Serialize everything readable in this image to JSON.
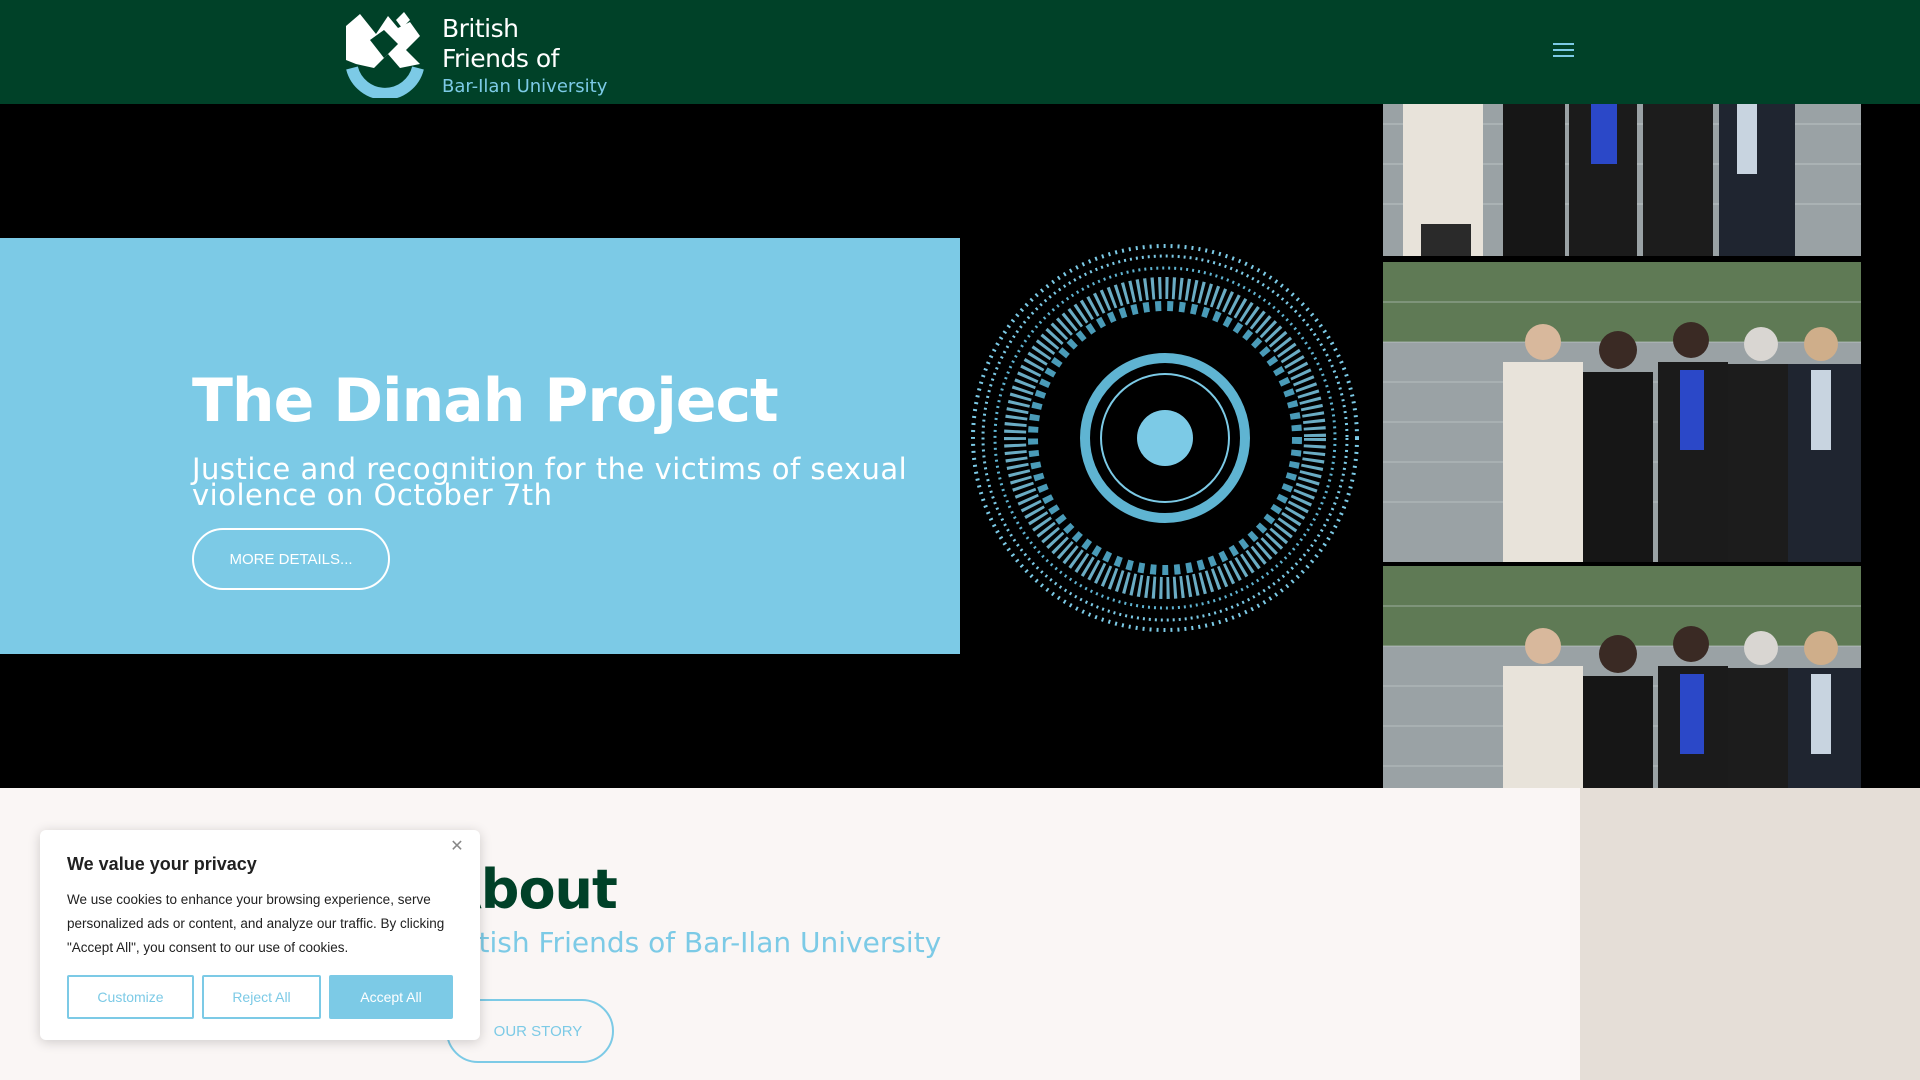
{
  "colors": {
    "header_bg": "#004128",
    "accent_blue": "#7ccae6",
    "hero_bg": "#000000",
    "page_bg": "#faf6f5",
    "side_panel": "#e5ded7"
  },
  "header": {
    "logo": {
      "line1": "British",
      "line2": "Friends of",
      "line3": "Bar-Ilan University",
      "icon": "bar-ilan-emblem-icon"
    },
    "menu_icon": "hamburger-menu-icon"
  },
  "hero": {
    "title": "The Dinah Project",
    "subtitle": "Justice and recognition for the victims of sexual violence on October 7th",
    "button_label": "MORE DETAILS..."
  },
  "about": {
    "title": "About",
    "subtitle": "British Friends of Bar-Ilan University",
    "button_label": "OUR STORY"
  },
  "cookie_banner": {
    "title": "We value your privacy",
    "text": "We use cookies to enhance your browsing experience, serve personalized ads or content, and analyze our traffic. By clicking \"Accept All\", you consent to our use of cookies.",
    "close_icon": "close-icon",
    "buttons": {
      "customize": "Customize",
      "reject": "Reject All",
      "accept": "Accept All"
    }
  }
}
